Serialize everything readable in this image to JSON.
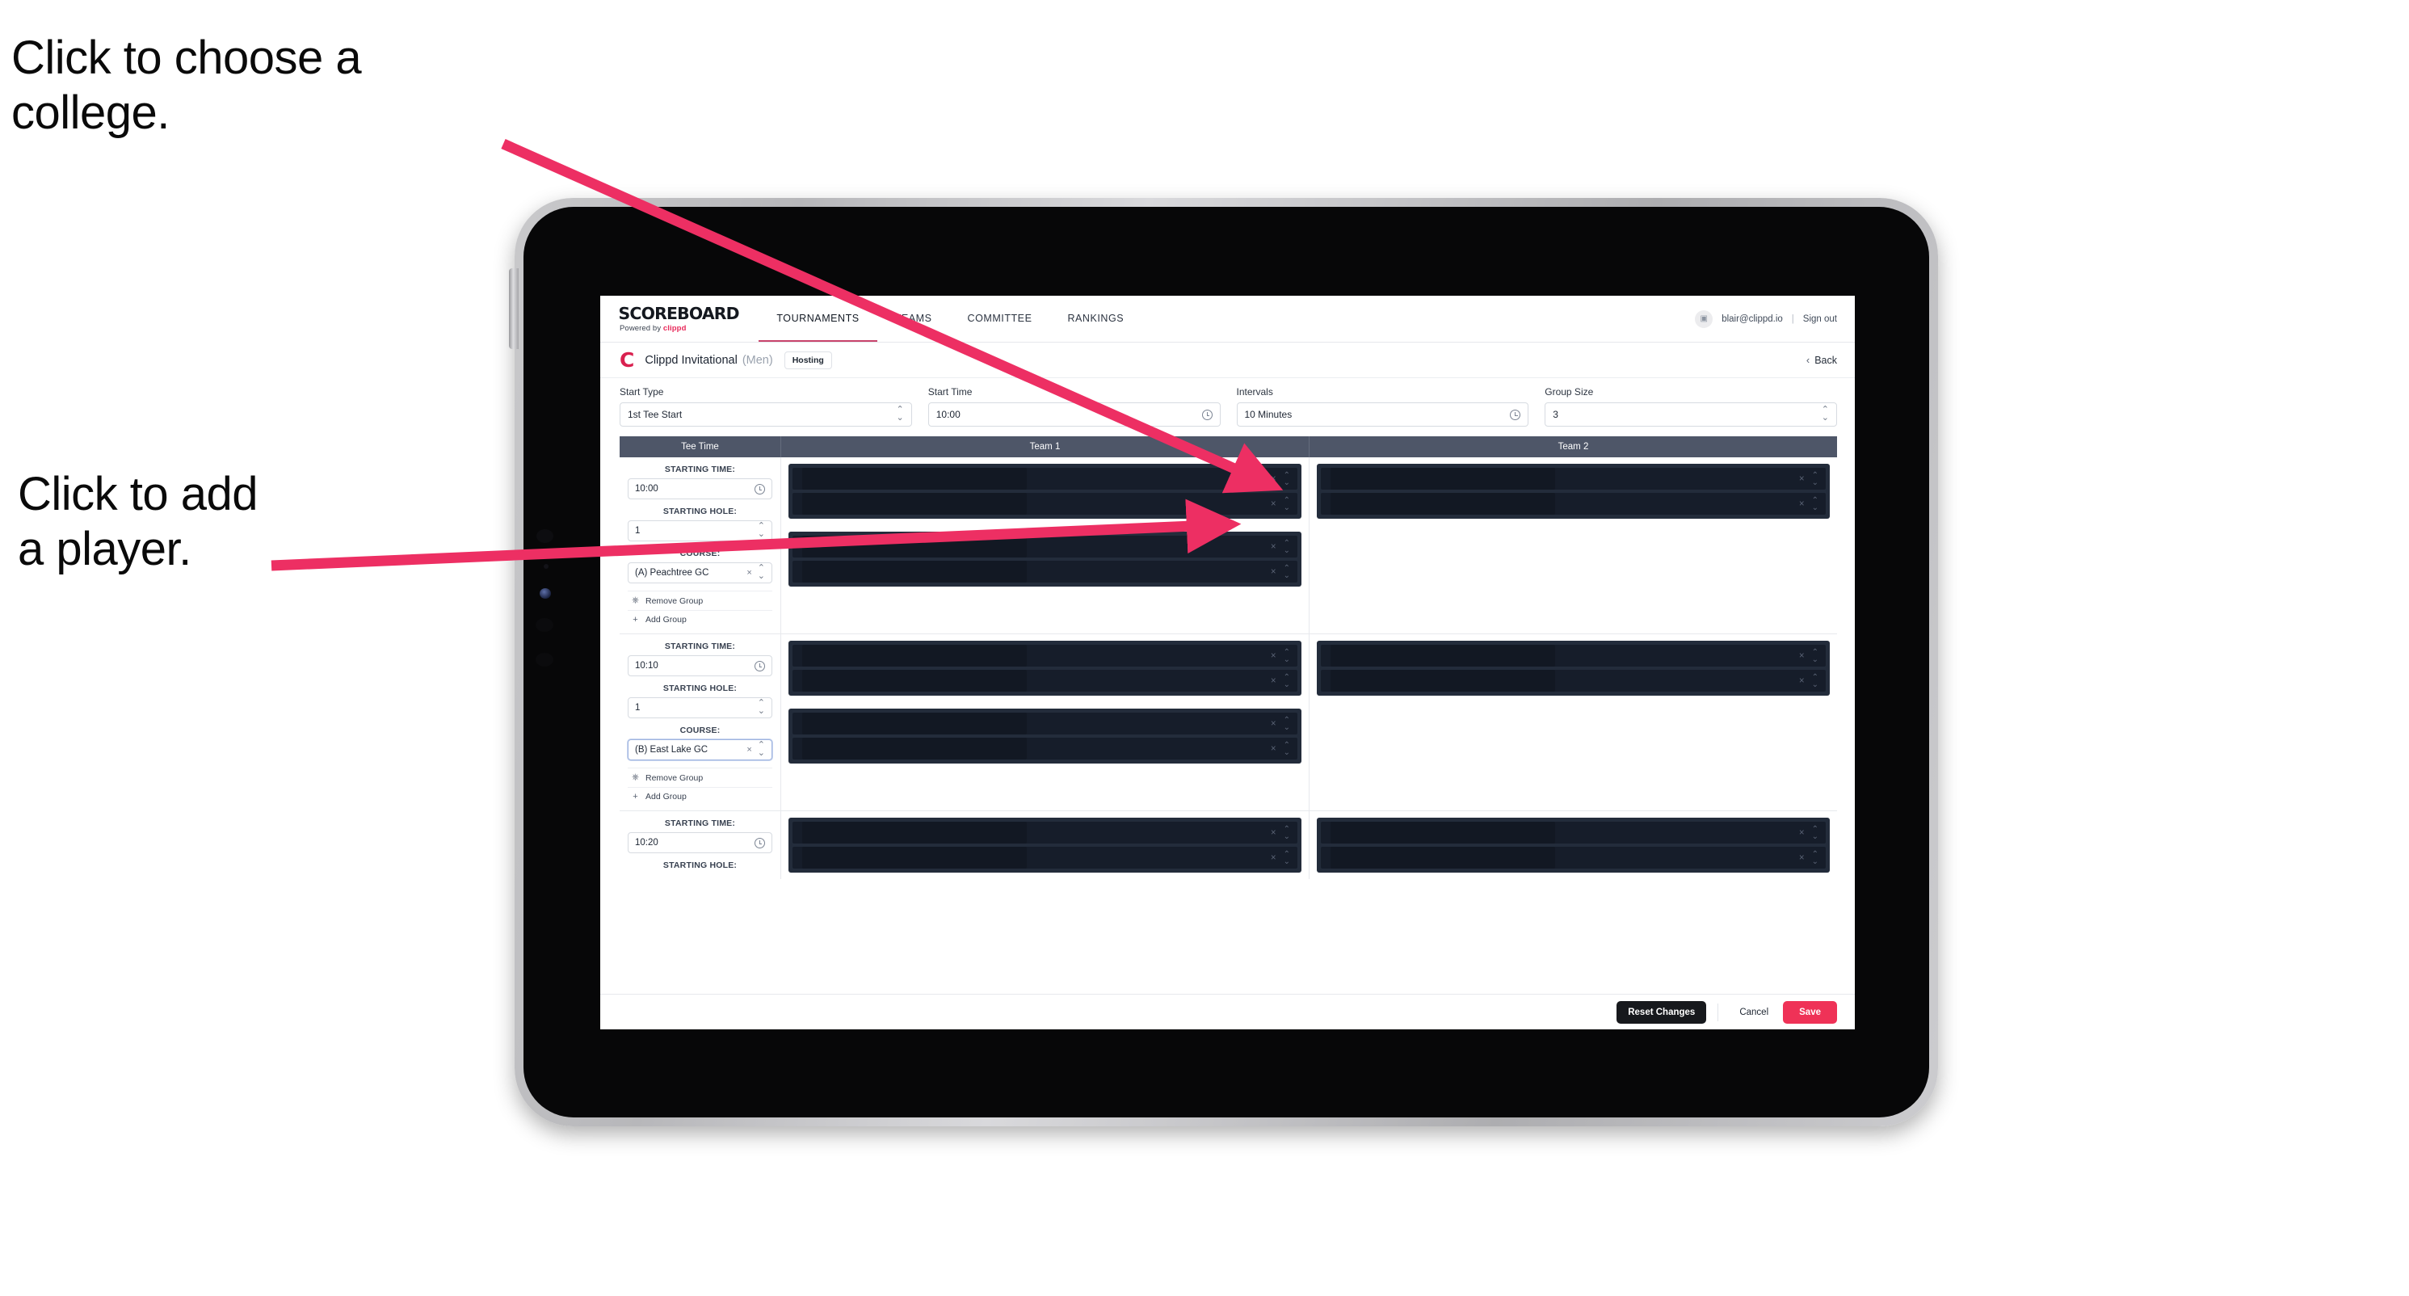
{
  "annotations": [
    {
      "id": "choose-college",
      "text": "Click to choose a\ncollege."
    },
    {
      "id": "add-player",
      "text": "Click to add\na player."
    }
  ],
  "colors": {
    "accent_pink": "#ef3257",
    "arrow_pink": "#ed2f63",
    "brand_red": "#d9214f",
    "table_header": "#4e5668",
    "slot_dark": "#232c3b"
  },
  "app": {
    "brand": {
      "wordmark": "SCOREBOARD",
      "powered_prefix": "Powered by",
      "powered_brand": "clippd"
    },
    "nav_tabs": [
      {
        "label": "TOURNAMENTS",
        "active": true
      },
      {
        "label": "TEAMS",
        "active": false
      },
      {
        "label": "COMMITTEE",
        "active": false
      },
      {
        "label": "RANKINGS",
        "active": false
      }
    ],
    "account": {
      "avatar_icon": "user-icon",
      "email": "blair@clippd.io",
      "separator": "|",
      "sign_out": "Sign out"
    },
    "tournament": {
      "logo_letter": "C",
      "name": "Clippd Invitational",
      "gender": "(Men)",
      "badge": "Hosting",
      "back_label": "Back",
      "back_chevron": "‹"
    },
    "settings": [
      {
        "label": "Start Type",
        "value": "1st Tee Start",
        "control": "stepper"
      },
      {
        "label": "Start Time",
        "value": "10:00",
        "control": "clock"
      },
      {
        "label": "Intervals",
        "value": "10 Minutes",
        "control": "clock"
      },
      {
        "label": "Group Size",
        "value": "3",
        "control": "stepper"
      }
    ],
    "grid": {
      "headers": {
        "tee_time": "Tee Time",
        "team_1": "Team 1",
        "team_2": "Team 2"
      },
      "labels": {
        "starting_time": "STARTING TIME:",
        "starting_hole": "STARTING HOLE:",
        "course": "COURSE:",
        "remove_group": "Remove Group",
        "add_group": "Add Group",
        "remove_icon": "trash-icon",
        "add_icon": "plus-icon",
        "clear_icon": "×",
        "spinner_icon": "⌃⌄"
      },
      "rows": [
        {
          "starting_time": "10:00",
          "starting_hole": "1",
          "course": "(A) Peachtree GC",
          "course_focused": false,
          "team_1_blocks": [
            {
              "slots": 2
            },
            {
              "slots": 2
            }
          ],
          "team_2_blocks": [
            {
              "slots": 2
            }
          ]
        },
        {
          "starting_time": "10:10",
          "starting_hole": "1",
          "course": "(B) East Lake GC",
          "course_focused": true,
          "team_1_blocks": [
            {
              "slots": 2
            },
            {
              "slots": 2
            }
          ],
          "team_2_blocks": [
            {
              "slots": 2
            }
          ]
        },
        {
          "starting_time": "10:20",
          "starting_hole": "",
          "course": "",
          "course_focused": false,
          "team_1_blocks": [
            {
              "slots": 2
            }
          ],
          "team_2_blocks": [
            {
              "slots": 2
            }
          ]
        }
      ]
    },
    "footer": {
      "reset": "Reset Changes",
      "cancel": "Cancel",
      "save": "Save"
    }
  }
}
